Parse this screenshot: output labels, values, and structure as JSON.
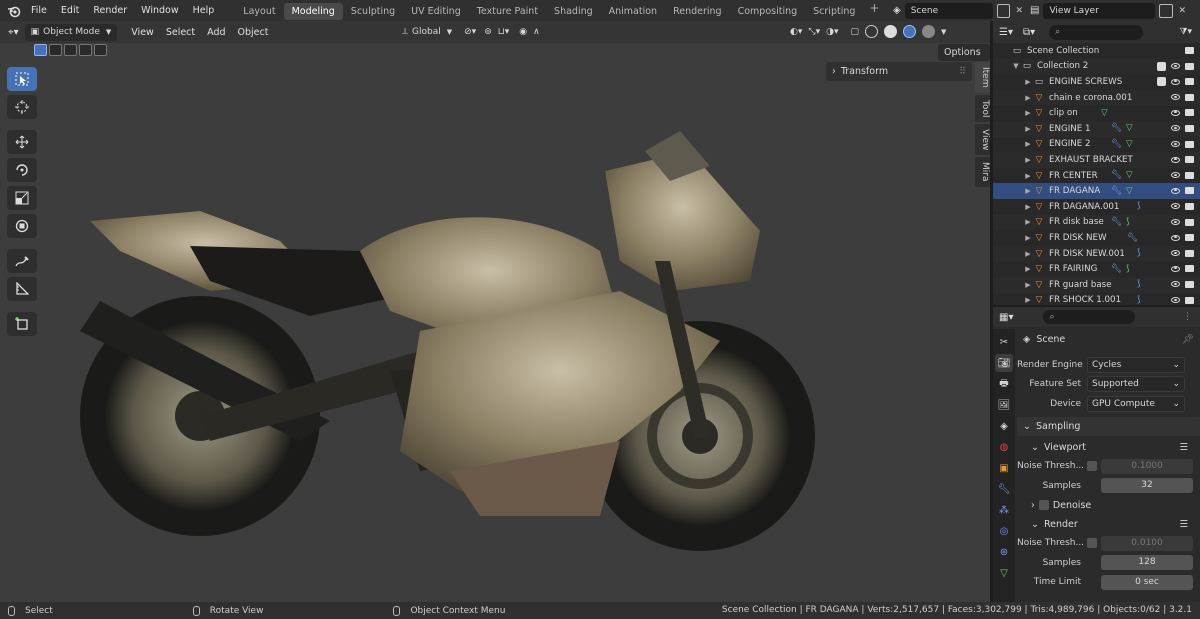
{
  "topbar": {
    "menus": [
      "File",
      "Edit",
      "Render",
      "Window",
      "Help"
    ],
    "workspaces": [
      "Layout",
      "Modeling",
      "Sculpting",
      "UV Editing",
      "Texture Paint",
      "Shading",
      "Animation",
      "Rendering",
      "Compositing",
      "Scripting"
    ],
    "active_workspace": "Modeling",
    "scene_name": "Scene",
    "view_layer": "View Layer"
  },
  "viewport": {
    "mode": "Object Mode",
    "menus": [
      "View",
      "Select",
      "Add",
      "Object"
    ],
    "orientation": "Global",
    "options_label": "Options",
    "transform_panel": "Transform",
    "side_tabs": [
      "Item",
      "Tool",
      "View",
      "Mira"
    ]
  },
  "outliner": {
    "scene_collection": "Scene Collection",
    "collection": "Collection 2",
    "items": [
      "ENGINE SCREWS",
      "chain e corona.001",
      "clip on",
      "ENGINE 1",
      "ENGINE 2",
      "EXHAUST BRACKET",
      "FR CENTER",
      "FR DAGANA",
      "FR DAGANA.001",
      "FR disk base",
      "FR DISK NEW",
      "FR DISK NEW.001",
      "FR FAIRING",
      "FR guard base",
      "FR SHOCK 1.001"
    ],
    "selected": "FR DAGANA"
  },
  "properties": {
    "scene_label": "Scene",
    "render_engine_label": "Render Engine",
    "render_engine": "Cycles",
    "feature_set_label": "Feature Set",
    "feature_set": "Supported",
    "device_label": "Device",
    "device": "GPU Compute",
    "sampling": "Sampling",
    "viewport": "Viewport",
    "noise_thresh_label": "Noise Thresh...",
    "viewport_noise": "0.1000",
    "samples_label": "Samples",
    "viewport_samples": "32",
    "denoise": "Denoise",
    "render": "Render",
    "render_noise": "0.0100",
    "render_samples": "128",
    "time_limit_label": "Time Limit",
    "time_limit": "0 sec"
  },
  "statusbar": {
    "select": "Select",
    "rotate": "Rotate View",
    "context": "Object Context Menu",
    "info": "Scene Collection | FR DAGANA | Verts:2,517,657 | Faces:3,302,799 | Tris:4,989,796 | Objects:0/62 | 3.2.1"
  },
  "colors": {
    "accent": "#4772b3",
    "mesh_orange": "#e8962e",
    "modifier_blue": "#7a9dff",
    "vgroup_green": "#5fd37e"
  }
}
